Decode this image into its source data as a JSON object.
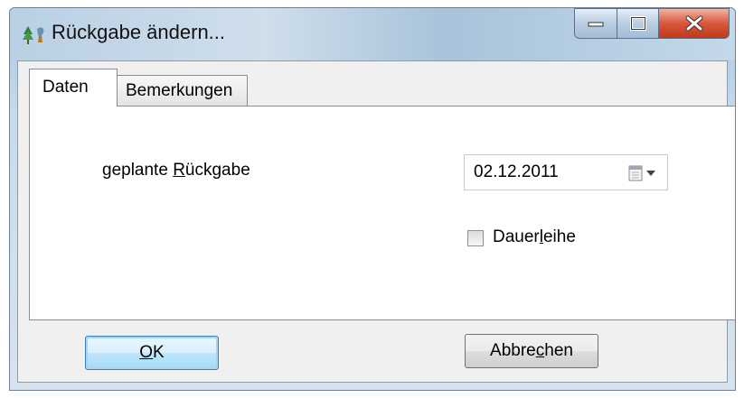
{
  "window": {
    "title": "Rückgabe ändern..."
  },
  "tabs": [
    {
      "label": "Daten",
      "active": true
    },
    {
      "label": "Bemerkungen",
      "active": false
    }
  ],
  "form": {
    "planned_return_label_pre": "geplante ",
    "planned_return_label_accel": "R",
    "planned_return_label_post": "ückgabe",
    "date_value": "02.12.2011",
    "permanent_loan_label_pre": "Dauer",
    "permanent_loan_label_accel": "l",
    "permanent_loan_label_post": "eihe",
    "permanent_loan_checked": false
  },
  "buttons": {
    "ok_accel": "O",
    "ok_rest": "K",
    "cancel_pre": "Abbre",
    "cancel_accel": "c",
    "cancel_post": "hen"
  },
  "icons": {
    "app": "tree-icon",
    "minimize": "minimize-icon",
    "maximize": "maximize-icon",
    "close": "close-icon",
    "calendar": "calendar-dropdown-icon"
  }
}
